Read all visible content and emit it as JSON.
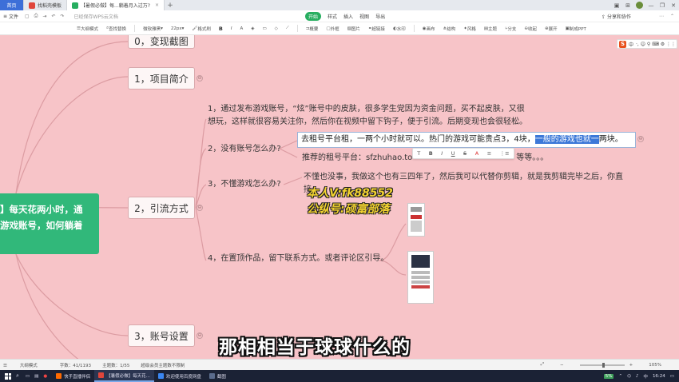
{
  "tabs": {
    "home": "首页",
    "tab1": "找稻壳模板",
    "tab2": "【暑假必做】每...躺着月入过万?",
    "close_symbol": "×",
    "new_tab_symbol": "+"
  },
  "window_controls": {
    "minimize": "—",
    "restore": "❐",
    "close": "✕"
  },
  "menubar": {
    "file": "文件",
    "quick_status": "已经保存WPS云文档",
    "start": "开始",
    "style": "样式",
    "insert": "插入",
    "view": "视图",
    "export": "导出",
    "share": "分享和协作"
  },
  "toolbar": {
    "outline_mode": "大纲模式",
    "find_replace": "查找替换",
    "font": "微软雅黑",
    "font_size": "22px",
    "format_painter": "格式刷",
    "bold": "B",
    "italic": "I",
    "summary": "概要",
    "frame": "外框",
    "image": "图片",
    "hyperlink": "超链接",
    "watermark": "水印",
    "canvas": "画布",
    "structure": "结构",
    "style": "风格",
    "theme": "主题",
    "branch": "分支",
    "collapse": "收起",
    "expand": "展开",
    "make_ppt": "制成PPT"
  },
  "mindmap": {
    "root_text_line1": "】每天花两小时，通",
    "root_text_line2": "游戏账号，如何躺着",
    "node_0": "0，变现截图",
    "node_1": "1，项目简介",
    "node_2": "2，引流方式",
    "node_3": "3，账号设置",
    "collapse_symbol": "⊖",
    "item1_line1": "1，通过发布游戏账号，“炫”账号中的皮肤，很多学生党因为资金问题，买不起皮肤，又很",
    "item1_line2": "想玩，这样就很容易关注你，然后你在视频中留下钩子，便于引流。后期变现也会很轻松。",
    "item2": "2，没有账号怎么办?",
    "edit_prefix": "去租号平台租，一两个小时就可以。热门的游戏可能贵点3，4块，",
    "edit_highlight": "一般的游戏也就一",
    "edit_suffix": "两块。",
    "item2_sub_prefix": "推荐的租号平台：sfzhuhao.to",
    "item2_sub_suffix": "等等。。。",
    "item3": "3，不懂游戏怎么办?",
    "item3_line1": "不懂也没事，我做这个也有三四年了，然后我可以代替你剪辑，就是我剪辑完毕之后，你直",
    "item3_line2": "接",
    "item4": "4，在置顶作品，留下联系方式。或者评论区引导。"
  },
  "format_bar": {
    "text": "T",
    "bold": "B",
    "italic": "I",
    "underline": "U",
    "strike": "S",
    "color": "A",
    "list_bullet": "≡",
    "list_number": "⋮≡"
  },
  "watermark": {
    "line1": "本人V:fk88552",
    "line2": "公纵号:硕富部落"
  },
  "subtitle": "那相相当于球球什么的",
  "ime": {
    "logo": "S",
    "lang": "中",
    "items": "·, ☺ ⚲ ⌨ ⚙ ⋮⋮"
  },
  "statusbar": {
    "outline_mode": "大纲模式",
    "word_count": "字数：41/1193",
    "topic_count": "主题数：1/55",
    "member_notice": "超级会员主题数不限制",
    "zoom_minus": "−",
    "zoom_plus": "+",
    "zoom_value": "105%"
  },
  "taskbar": {
    "search_symbol": "⌕",
    "task1": "快手直播伴侣",
    "task2": "【暑假必做】每天花...",
    "task3": "欢迎使用百度网盘",
    "task4": "截图",
    "battery": "5%",
    "ime": "中",
    "time": "16:24"
  }
}
